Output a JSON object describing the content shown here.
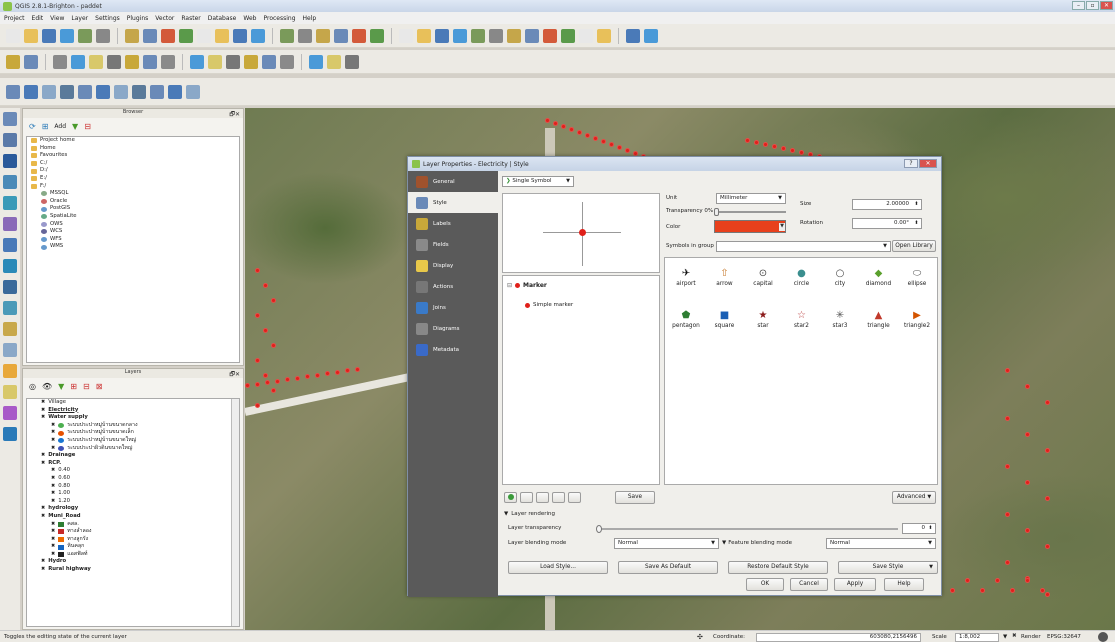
{
  "window": {
    "title": "QGIS 2.8.1-Brighton - paddet"
  },
  "menu": [
    "Project",
    "Edit",
    "View",
    "Layer",
    "Settings",
    "Plugins",
    "Vector",
    "Raster",
    "Database",
    "Web",
    "Processing",
    "Help"
  ],
  "browser": {
    "title": "Browser",
    "add_label": "Add",
    "items": [
      "Project home",
      "Home",
      "Favourites",
      "C:/",
      "D:/",
      "E:/",
      "F:/",
      "MSSQL",
      "Oracle",
      "PostGIS",
      "SpatiaLite",
      "OWS",
      "WCS",
      "WFS",
      "WMS"
    ]
  },
  "layers": {
    "title": "Layers",
    "items": [
      {
        "label": "Village"
      },
      {
        "label": "Electricity",
        "bold": true
      },
      {
        "label": "Water supply",
        "bold": true
      },
      {
        "label": "ระบบประปาหมู่บ้านขนาดกลาง",
        "color": "#4caf50"
      },
      {
        "label": "ระบบประปาหมู่บ้านขนาดเล็ก",
        "color": "#e65100"
      },
      {
        "label": "ระบบประปาหมู่บ้านขนาดใหญ่",
        "color": "#1976d2"
      },
      {
        "label": "ระบบประปาผิวดินขนาดใหญ่",
        "color": "#3f51b5"
      },
      {
        "label": "Drainage",
        "bold": true
      },
      {
        "label": "RCP.",
        "bold": true
      },
      {
        "label": "0.40"
      },
      {
        "label": "0.60"
      },
      {
        "label": "0.80"
      },
      {
        "label": "1.00"
      },
      {
        "label": "1.20"
      },
      {
        "label": "hydrology",
        "bold": true
      },
      {
        "label": "Muni_Road",
        "bold": true
      },
      {
        "label": "คสล.",
        "color": "#2e7d32"
      },
      {
        "label": "ทางลำลอง",
        "color": "#c62828"
      },
      {
        "label": "ทางลูกรัง",
        "color": "#ef6c00"
      },
      {
        "label": "หินคลุก",
        "color": "#1565c0"
      },
      {
        "label": "แอสฟัลท์",
        "color": "#212121"
      },
      {
        "label": "Hydro",
        "bold": true
      },
      {
        "label": "Rural highway",
        "bold": true
      }
    ]
  },
  "dialog": {
    "title": "Layer Properties - Electricity | Style",
    "sidebar": [
      "General",
      "Style",
      "Labels",
      "Fields",
      "Display",
      "Actions",
      "Joins",
      "Diagrams",
      "Metadata"
    ],
    "renderer": "Single Symbol",
    "tree": {
      "root": "Marker",
      "child": "Simple marker"
    },
    "unit_label": "Unit",
    "unit_value": "Millimeter",
    "transparency_label": "Transparency 0%",
    "color_label": "Color",
    "color_value": "#e8401c",
    "size_label": "Size",
    "size_value": "2.00000",
    "rotation_label": "Rotation",
    "rotation_value": "0.00°",
    "symbols_in_group_label": "Symbols in group",
    "open_library": "Open Library",
    "symbols": [
      {
        "name": "airport",
        "glyph": "✈",
        "color": "#111"
      },
      {
        "name": "arrow",
        "glyph": "⇧",
        "color": "#c77a2e"
      },
      {
        "name": "capital",
        "glyph": "⊙",
        "color": "#444"
      },
      {
        "name": "circle",
        "glyph": "●",
        "color": "#3a8e8e"
      },
      {
        "name": "city",
        "glyph": "○",
        "color": "#444"
      },
      {
        "name": "diamond",
        "glyph": "◆",
        "color": "#5aa02c"
      },
      {
        "name": "ellipse",
        "glyph": "⬭",
        "color": "#555"
      },
      {
        "name": "pentagon",
        "glyph": "⬟",
        "color": "#2e7d32"
      },
      {
        "name": "square",
        "glyph": "■",
        "color": "#1a5fb4"
      },
      {
        "name": "star",
        "glyph": "★",
        "color": "#8b1a1a"
      },
      {
        "name": "star2",
        "glyph": "☆",
        "color": "#b44"
      },
      {
        "name": "star3",
        "glyph": "✳",
        "color": "#555"
      },
      {
        "name": "triangle",
        "glyph": "▲",
        "color": "#c0392b"
      },
      {
        "name": "triangle2",
        "glyph": "▶",
        "color": "#d35400"
      }
    ],
    "save_btn": "Save",
    "advanced_btn": "Advanced",
    "layer_rendering": "Layer rendering",
    "layer_transparency_label": "Layer transparency",
    "layer_transparency_value": "0",
    "layer_blending_label": "Layer blending mode",
    "layer_blending_value": "Normal",
    "feature_blending_label": "Feature blending mode",
    "feature_blending_value": "Normal",
    "load_style": "Load Style...",
    "save_default": "Save As Default",
    "restore_default": "Restore Default Style",
    "save_style": "Save Style",
    "ok": "OK",
    "cancel": "Cancel",
    "apply": "Apply",
    "help": "Help"
  },
  "status": {
    "message": "Toggles the editing state of the current layer",
    "coordinate_label": "Coordinate:",
    "coordinate_value": "603080,2156496",
    "scale_label": "Scale",
    "scale_value": "1:8,002",
    "render_label": "Render",
    "crs": "EPSG:32647"
  }
}
